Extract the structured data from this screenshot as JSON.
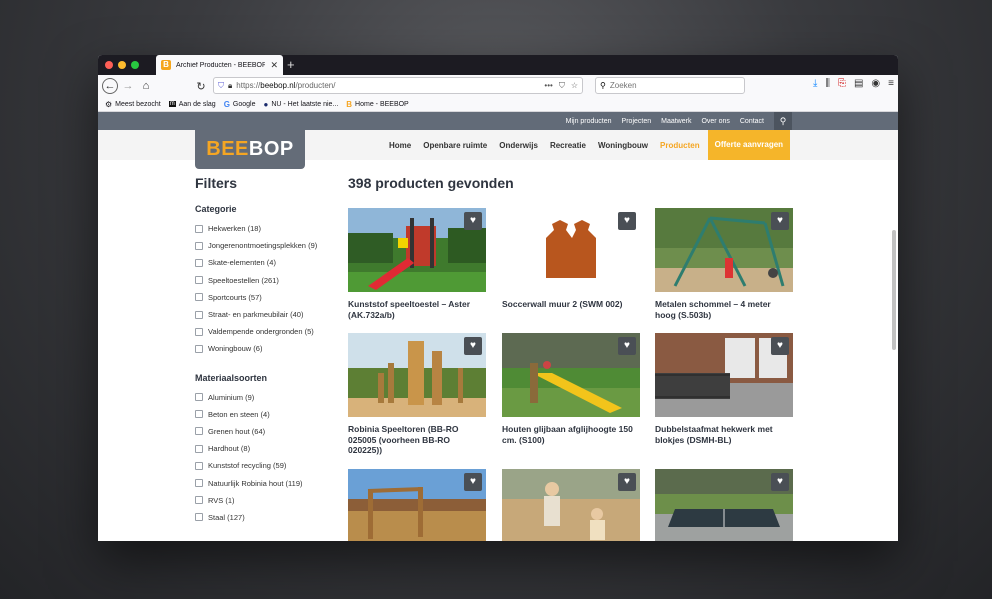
{
  "browser": {
    "tab_title": "Archief Producten - BEEBOP",
    "tab_favicon": "B",
    "new_tab": "+",
    "url_prefix": "https://",
    "url_domain": "beebop.nl",
    "url_path": "/producten/",
    "search_placeholder": "Zoeken",
    "bookmarks": [
      {
        "label": "Meest bezocht",
        "icon": "gear-icon"
      },
      {
        "label": "Aan de slag",
        "icon": "folder-icon"
      },
      {
        "label": "Google",
        "icon": "google-icon"
      },
      {
        "label": "NU - Het laatste nie...",
        "icon": "nu-icon"
      },
      {
        "label": "Home - BEEBOP",
        "icon": "beebop-icon"
      }
    ]
  },
  "site": {
    "top_links": [
      "Mijn producten",
      "Projecten",
      "Maatwerk",
      "Over ons",
      "Contact"
    ],
    "logo_bee": "BEE",
    "logo_bop": "BOP",
    "menu": [
      "Home",
      "Openbare ruimte",
      "Onderwijs",
      "Recreatie",
      "Woningbouw",
      "Producten"
    ],
    "menu_active": "Producten",
    "cta": "Offerte aanvragen",
    "colors": {
      "accent": "#f5a623",
      "topbar": "#626b78",
      "text": "#2f3540"
    }
  },
  "filters": {
    "title": "Filters",
    "category_title": "Categorie",
    "categories": [
      "Hekwerken (18)",
      "Jongerenontmoetingsplekken (9)",
      "Skate-elementen (4)",
      "Speeltoestellen (261)",
      "Sportcourts (57)",
      "Straat- en parkmeubilair (40)",
      "Valdempende ondergronden (5)",
      "Woningbouw (6)"
    ],
    "material_title": "Materiaalsoorten",
    "materials": [
      "Aluminium (9)",
      "Beton en steen (4)",
      "Grenen hout (64)",
      "Hardhout (8)",
      "Kunststof recycling (59)",
      "Natuurlijk Robinia hout (119)",
      "RVS (1)",
      "Staal (127)"
    ]
  },
  "results": {
    "count_text": "398 producten gevonden",
    "products": [
      {
        "name": "Kunststof speeltoestel – Aster (AK.732a/b)",
        "scene": "playground-red-slide"
      },
      {
        "name": "Soccerwall muur 2 (SWM 002)",
        "scene": "corten-soccer-wall"
      },
      {
        "name": "Metalen schommel – 4 meter hoog (S.503b)",
        "scene": "metal-swing"
      },
      {
        "name": "Robinia Speeltoren (BB-RO 025005 (voorheen BB-RO 020225))",
        "scene": "robinia-tower"
      },
      {
        "name": "Houten glijbaan afglijhoogte 150 cm. (S100)",
        "scene": "yellow-slide"
      },
      {
        "name": "Dubbelstaafmat hekwerk met blokjes (DSMH-BL)",
        "scene": "fence-house"
      },
      {
        "name": "",
        "scene": "wooden-climbing-frame"
      },
      {
        "name": "",
        "scene": "sandbox-kids"
      },
      {
        "name": "",
        "scene": "table-tennis"
      }
    ]
  }
}
